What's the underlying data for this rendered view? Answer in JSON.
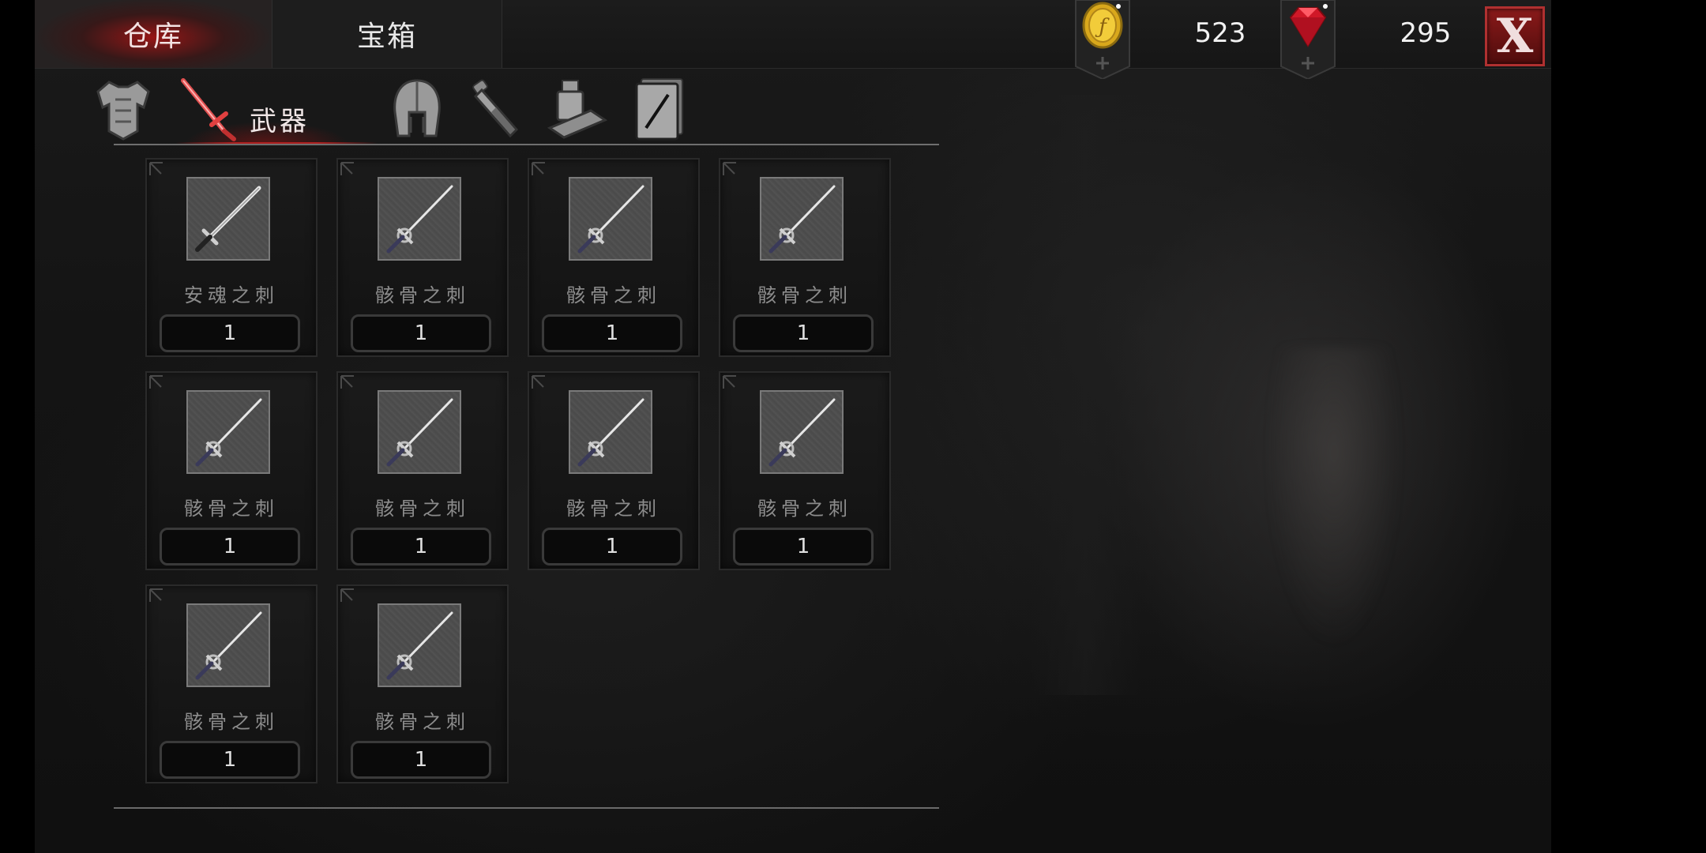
{
  "top_bar": {
    "tabs": [
      {
        "label": "仓库",
        "active": true
      },
      {
        "label": "宝箱",
        "active": false
      }
    ],
    "currencies": [
      {
        "icon": "gold-coin-icon",
        "value": "523",
        "add_icon": "plus-icon"
      },
      {
        "icon": "red-gem-icon",
        "value": "295",
        "add_icon": "plus-icon"
      }
    ],
    "close_label": "X"
  },
  "category_tabs": [
    {
      "icon": "armor-icon",
      "label": ""
    },
    {
      "icon": "sword-icon",
      "label": "武器",
      "active": true
    },
    {
      "icon": "helmet-icon",
      "label": ""
    },
    {
      "icon": "potion-icon",
      "label": ""
    },
    {
      "icon": "scroll-icon",
      "label": ""
    },
    {
      "icon": "card-icon",
      "label": ""
    }
  ],
  "items": [
    {
      "name": "安魂之刺",
      "quantity": "1",
      "icon": "longsword-icon"
    },
    {
      "name": "骸骨之刺",
      "quantity": "1",
      "icon": "rapier-icon"
    },
    {
      "name": "骸骨之刺",
      "quantity": "1",
      "icon": "rapier-icon"
    },
    {
      "name": "骸骨之刺",
      "quantity": "1",
      "icon": "rapier-icon"
    },
    {
      "name": "骸骨之刺",
      "quantity": "1",
      "icon": "rapier-icon"
    },
    {
      "name": "骸骨之刺",
      "quantity": "1",
      "icon": "rapier-icon"
    },
    {
      "name": "骸骨之刺",
      "quantity": "1",
      "icon": "rapier-icon"
    },
    {
      "name": "骸骨之刺",
      "quantity": "1",
      "icon": "rapier-icon"
    },
    {
      "name": "骸骨之刺",
      "quantity": "1",
      "icon": "rapier-icon"
    },
    {
      "name": "骸骨之刺",
      "quantity": "1",
      "icon": "rapier-icon"
    }
  ],
  "colors": {
    "accent_red": "#b02020",
    "gold": "#e8c020",
    "gem_red": "#d01828"
  }
}
